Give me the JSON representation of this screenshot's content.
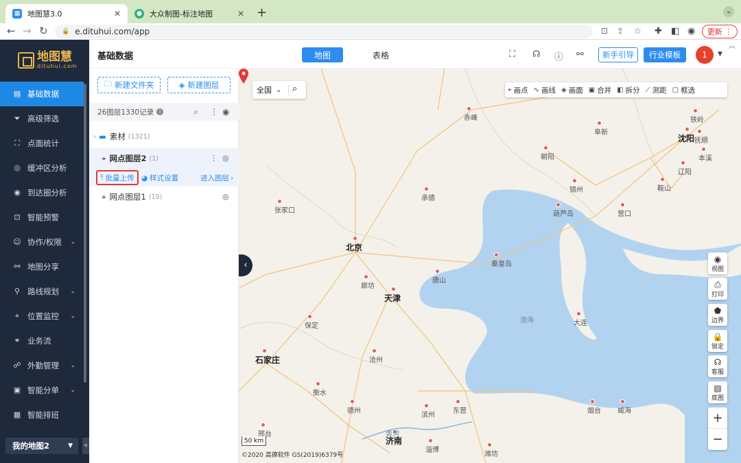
{
  "browser": {
    "tabs": [
      {
        "label": "地图慧3.0",
        "active": true
      },
      {
        "label": "大众制图-标注地图",
        "active": false
      }
    ],
    "url": "e.dituhui.com/app",
    "update_label": "更新"
  },
  "app": {
    "logo_name": "地图慧",
    "logo_sub": "dituhui.com",
    "page_title": "基础数据",
    "view_tabs": [
      "地图",
      "表格"
    ],
    "guide_label": "新手引导",
    "template_label": "行业模板",
    "avatar_text": "1"
  },
  "sidebar": {
    "items": [
      {
        "label": "基础数据",
        "icon": "table-icon",
        "active": true,
        "expandable": false
      },
      {
        "label": "高级筛选",
        "icon": "filter-icon",
        "active": false,
        "expandable": false
      },
      {
        "label": "点面统计",
        "icon": "stats-icon",
        "active": false,
        "expandable": false
      },
      {
        "label": "缓冲区分析",
        "icon": "buffer-icon",
        "active": false,
        "expandable": false
      },
      {
        "label": "到达圈分析",
        "icon": "reach-icon",
        "active": false,
        "expandable": false
      },
      {
        "label": "智能预警",
        "icon": "alert-icon",
        "active": false,
        "expandable": false
      },
      {
        "label": "协作/权限",
        "icon": "collab-icon",
        "active": false,
        "expandable": true
      },
      {
        "label": "地图分享",
        "icon": "share-icon",
        "active": false,
        "expandable": false
      },
      {
        "label": "路线规划",
        "icon": "route-icon",
        "active": false,
        "expandable": true
      },
      {
        "label": "位置监控",
        "icon": "monitor-icon",
        "active": false,
        "expandable": true
      },
      {
        "label": "业务流",
        "icon": "flow-icon",
        "active": false,
        "expandable": false
      },
      {
        "label": "外勤管理",
        "icon": "field-icon",
        "active": false,
        "expandable": true
      },
      {
        "label": "智能分单",
        "icon": "dispatch-icon",
        "active": false,
        "expandable": true
      },
      {
        "label": "智能排班",
        "icon": "schedule-icon",
        "active": false,
        "expandable": false
      }
    ],
    "my_map": "我的地图2"
  },
  "panel": {
    "new_folder": "新建文件夹",
    "new_layer": "新建图层",
    "summary": "26图层1330记录",
    "folder": {
      "label": "素材",
      "count": "(1321)"
    },
    "layer2": {
      "label": "网点图层2",
      "count": "(1)"
    },
    "layer1": {
      "label": "网点图层1",
      "count": "(10)"
    },
    "actions": {
      "batch_upload": "批量上传",
      "style_settings": "样式设置",
      "enter_layer": "进入图层"
    }
  },
  "map": {
    "region": "全国",
    "tools": [
      "画点",
      "画线",
      "画面",
      "合并",
      "拆分",
      "测距",
      "框选"
    ],
    "right_buttons": [
      "视图",
      "打印",
      "边界",
      "锁定",
      "客服",
      "底图"
    ],
    "scale": "50 km",
    "copyright": "©2020 高德软件 GS(2019)6379号",
    "cities": [
      {
        "name": "北京",
        "big": true
      },
      {
        "name": "天津",
        "big": true
      },
      {
        "name": "石家庄",
        "big": true
      },
      {
        "name": "沈阳",
        "big": true
      },
      {
        "name": "济南",
        "big": true
      },
      {
        "name": "赤峰"
      },
      {
        "name": "阜新"
      },
      {
        "name": "铁岭"
      },
      {
        "name": "抚顺"
      },
      {
        "name": "本溪"
      },
      {
        "name": "辽阳"
      },
      {
        "name": "鞍山"
      },
      {
        "name": "朝阳"
      },
      {
        "name": "锦州"
      },
      {
        "name": "葫芦岛"
      },
      {
        "name": "营口"
      },
      {
        "name": "承德"
      },
      {
        "name": "张家口"
      },
      {
        "name": "秦皇岛"
      },
      {
        "name": "唐山"
      },
      {
        "name": "廊坊"
      },
      {
        "name": "保定"
      },
      {
        "name": "沧州"
      },
      {
        "name": "衡水"
      },
      {
        "name": "德州"
      },
      {
        "name": "滨州"
      },
      {
        "name": "东营"
      },
      {
        "name": "烟台"
      },
      {
        "name": "威海"
      },
      {
        "name": "大连"
      },
      {
        "name": "淄博"
      },
      {
        "name": "潍坊"
      },
      {
        "name": "邢台"
      },
      {
        "name": "渤海",
        "sea": true
      },
      {
        "name": "黄河",
        "sea": true
      }
    ]
  }
}
